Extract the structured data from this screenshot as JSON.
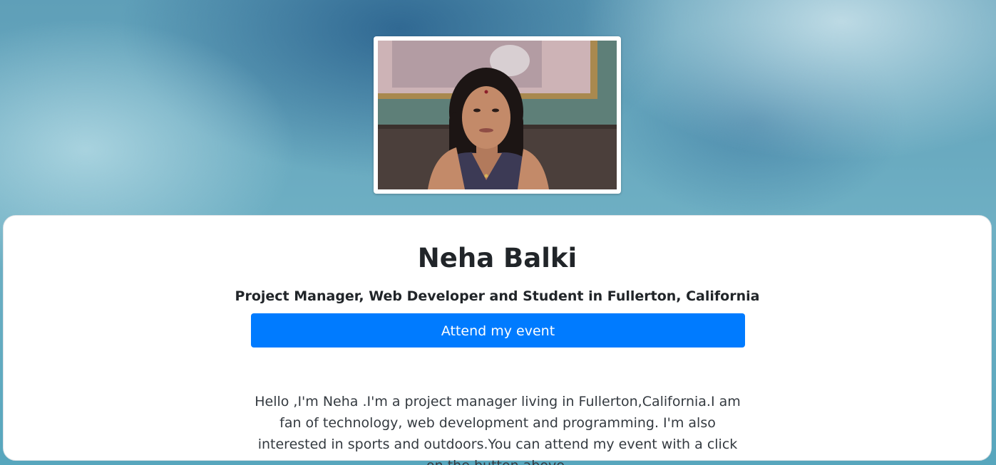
{
  "profile": {
    "photo_alt": "Neha Balki",
    "name": "Neha Balki",
    "title": "Project Manager, Web Developer and Student in Fullerton, California",
    "cta_label": "Attend my event",
    "bio": "Hello ,I'm Neha .I'm a project manager living in Fullerton,California.I am fan of technology, web development and programming. I'm also interested in sports and outdoors.You can attend my event with a click on the button above."
  },
  "colors": {
    "accent": "#007bff",
    "text": "#212529",
    "card_background": "#ffffff"
  }
}
